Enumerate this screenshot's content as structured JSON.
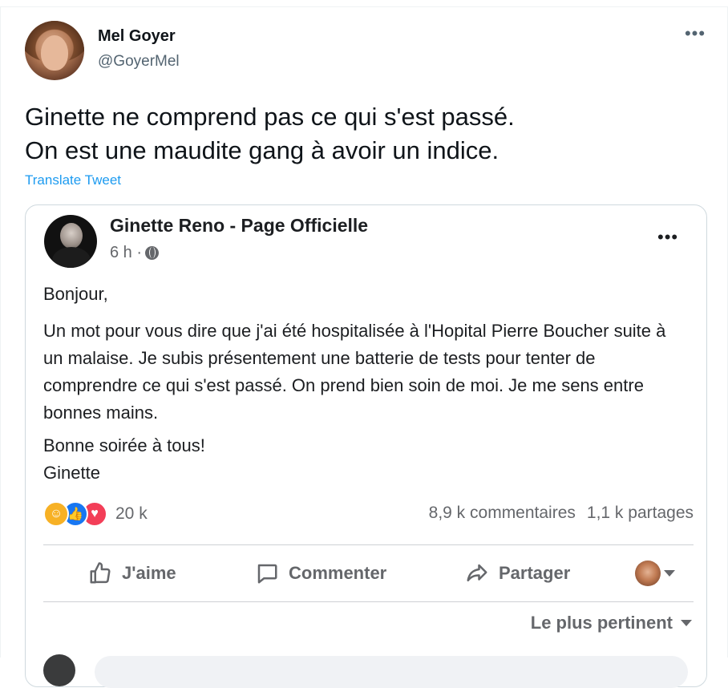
{
  "tweet": {
    "author_name": "Mel Goyer",
    "author_handle": "@GoyerMel",
    "more_label": "•••",
    "text_lines": [
      "Ginette ne comprend pas ce qui s'est passé.",
      "On est une maudite gang à avoir un indice."
    ],
    "translate_label": "Translate Tweet"
  },
  "fb_post": {
    "page_name": "Ginette Reno - Page Officielle",
    "time": "6 h ·",
    "more_label": "•••",
    "greeting": "Bonjour,",
    "body": "Un mot pour vous dire que j'ai été hospitalisée à l'Hopital Pierre Boucher suite à un malaise. Je subis présentement une batterie de tests pour tenter de comprendre ce qui s'est passé. On prend bien soin de moi. Je me sens entre bonnes mains.",
    "closing_lines": [
      "Bonne soirée à tous!",
      "Ginette"
    ],
    "reaction_count": "20 k",
    "comments_count": "8,9 k commentaires",
    "shares_count": "1,1 k partages",
    "actions": {
      "like": "J'aime",
      "comment": "Commenter",
      "share": "Partager"
    },
    "sort_label": "Le plus pertinent"
  },
  "icons": {
    "reactions": [
      "care-emoji-icon",
      "like-reaction-icon",
      "love-reaction-icon"
    ],
    "colors": {
      "like": "#1877f2",
      "love": "#f33e58",
      "care": "#f7b125",
      "link": "#1d9bf0"
    }
  }
}
